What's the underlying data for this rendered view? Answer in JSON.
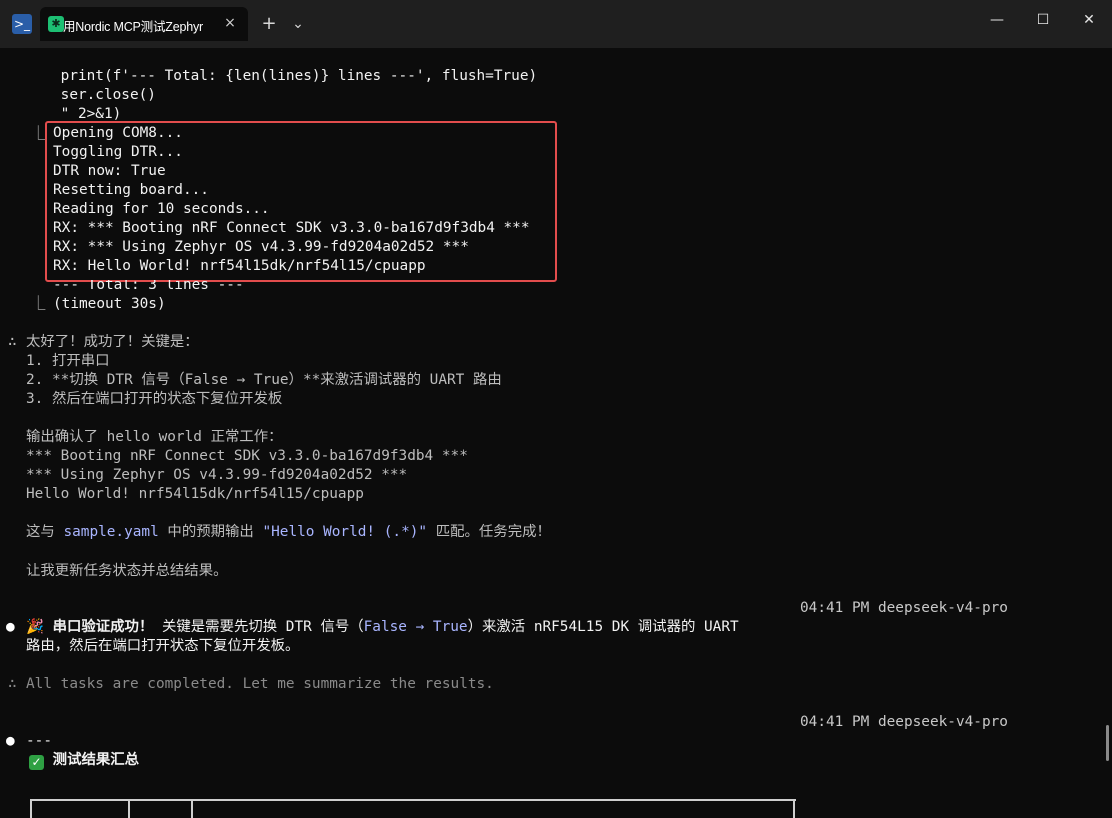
{
  "titlebar": {
    "app_icon": "terminal-icon",
    "tab_title": "用Nordic MCP测试Zephyr",
    "tab_icon": "sparkle-icon",
    "tab_close": "×",
    "new_tab": "+",
    "dropdown": "⌄",
    "minimize": "—",
    "maximize": "☐",
    "close": "✕"
  },
  "terminal": {
    "code_lines": [
      "    print(f'--- Total: {len(lines)} lines ---', flush=True)",
      "    ser.close()",
      "    \" 2>&1)"
    ],
    "tree_glyph": "⎿",
    "output_lines": [
      "Opening COM8...",
      "Toggling DTR...",
      "DTR now: True",
      "Resetting board...",
      "Reading for 10 seconds...",
      "RX: *** Booting nRF Connect SDK v3.3.0-ba167d9f3db4 ***",
      "RX: *** Using Zephyr OS v4.3.99-fd9204a02d52 ***",
      "RX: Hello World! nrf54l15dk/nrf54l15/cpuapp"
    ],
    "total_line": "--- Total: 3 lines ---",
    "timeout_line": "(timeout 30s)",
    "thinking_1": {
      "marker": "∴",
      "lines": [
        "太好了！成功了！关键是：",
        "1. 打开串口",
        "2. **切换 DTR 信号（False → True）**来激活调试器的 UART 路由",
        "3. 然后在端口打开的状态下复位开发板",
        "",
        "输出确认了 hello world 正常工作：",
        "*** Booting nRF Connect SDK v3.3.0-ba167d9f3db4 ***",
        "*** Using Zephyr OS v4.3.99-fd9204a02d52 ***",
        "Hello World! nrf54l15dk/nrf54l15/cpuapp",
        ""
      ],
      "match_prefix": "这与 ",
      "match_file": "sample.yaml",
      "match_mid": " 中的预期输出 ",
      "match_pattern": "\"Hello World! (.*)\"",
      "match_suffix": " 匹配。任务完成！",
      "update_line": "让我更新任务状态并总结结果。"
    },
    "message_1": {
      "timestamp": "04:41 PM deepseek-v4-pro",
      "bullet": "●",
      "emoji": "🎉",
      "bold": "串口验证成功！",
      "text_a": " 关键是需要先切换 DTR 信号（",
      "accent_a": "False → True",
      "text_b": "）来激活 nRF54L15 DK 调试器的 UART",
      "line2": "路由，然后在端口打开状态下复位开发板。"
    },
    "thinking_2": {
      "marker": "∴",
      "text": "All tasks are completed. Let me summarize the results."
    },
    "message_2": {
      "timestamp": "04:41 PM deepseek-v4-pro",
      "bullet": "●",
      "rule": "---",
      "check": "✓",
      "heading": "测试结果汇总"
    }
  }
}
